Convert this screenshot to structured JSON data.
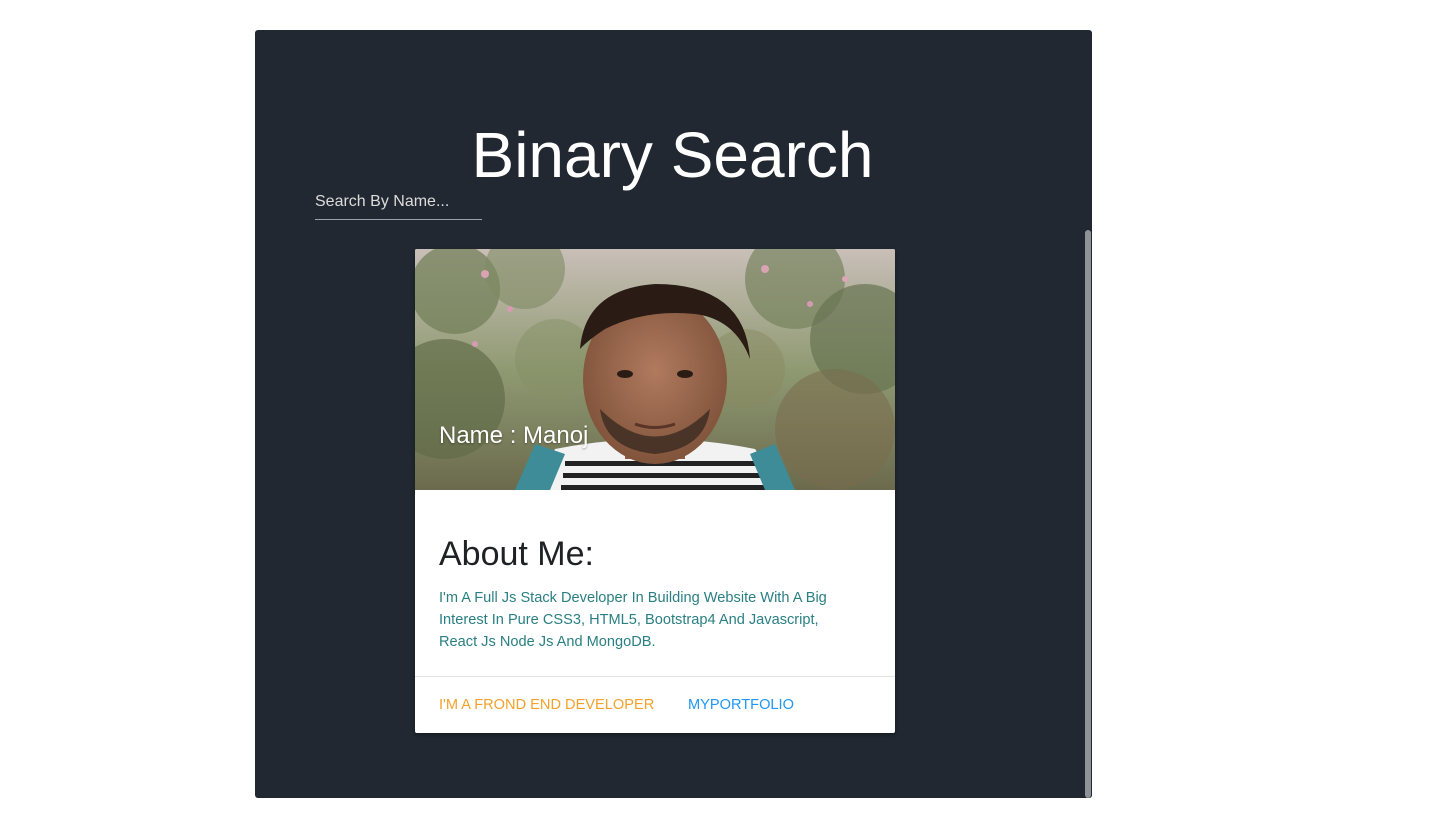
{
  "header": {
    "title": "Binary Search"
  },
  "search": {
    "placeholder": "Search By Name...",
    "value": ""
  },
  "card": {
    "image_description_icon": "profile-photo",
    "name_text": "Name : Manoj",
    "about_title": "About Me:",
    "about_text": "I'm A Full Js Stack Developer In Building Website With A Big Interest In Pure CSS3, HTML5, Bootstrap4 And Javascript, React Js Node Js And MongoDB.",
    "actions": [
      {
        "label": "I'M A FROND END DEVELOPER"
      },
      {
        "label": "MYPORTFOLIO"
      }
    ]
  },
  "colors": {
    "panel_bg": "#222831",
    "accent_orange": "#f3a12b",
    "accent_blue": "#2196f3",
    "about_text": "#2a7f82"
  }
}
